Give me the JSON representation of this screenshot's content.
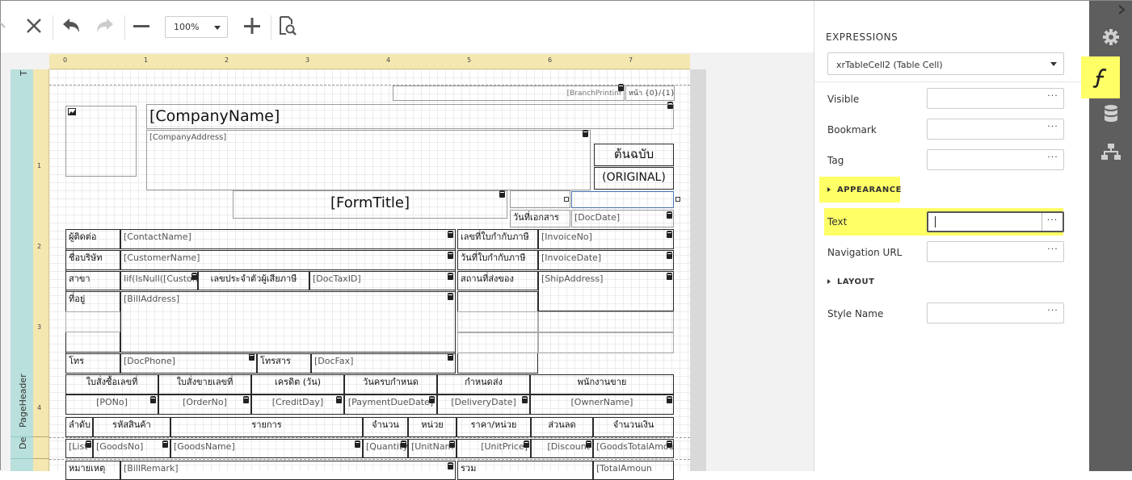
{
  "toolbar": {
    "zoom_value": "100%",
    "buttons": [
      "close-icon",
      "undo-icon",
      "redo-icon",
      "zoom-out-icon",
      "zoom-in-icon",
      "preview-icon"
    ]
  },
  "ruler": {
    "h_marks": [
      "0",
      "1",
      "2",
      "3",
      "4",
      "5",
      "6",
      "7"
    ],
    "v_marks": [
      "1",
      "2",
      "3",
      "4"
    ]
  },
  "bands": {
    "top": "T",
    "page_header": "PageHeader",
    "detail": "De"
  },
  "report": {
    "branch_printing": "[BranchPrintinf",
    "page_of": "หน้า {0}/{1}",
    "company_name": "[CompanyName]",
    "company_address": "[CompanyAddress]",
    "original_th": "ต้นฉบับ",
    "original_en": "(ORIGINAL)",
    "form_title": "[FormTitle]",
    "doc_date_label": "วันที่เอกสาร",
    "doc_date": "[DocDate]",
    "contact_label": "ผู้ติดต่อ",
    "contact_name": "[ContactName]",
    "invoice_no_label": "เลขที่ใบกำกับภาษี",
    "invoice_no": "[InvoiceNo]",
    "customer_label": "ชื่อบริษัท",
    "customer_name": "[CustomerName]",
    "invoice_date_label": "วันที่ใบกำกับภาษี",
    "invoice_date": "[InvoiceDate]",
    "branch_label": "สาขา",
    "branch_expr": "Iif(IsNull([Custom",
    "taxid_label": "เลขประจำตัวผู้เสียภาษี",
    "taxid": "[DocTaxID]",
    "ship_label": "สถานที่ส่งของ",
    "ship_address": "[ShipAddress]",
    "address_label": "ที่อยู่",
    "bill_address": "[BillAddress]",
    "phone_label": "โทร",
    "phone": "[DocPhone]",
    "fax_label": "โทรสาร",
    "fax": "[DocFax]",
    "header1": [
      "ใบสั่งซื้อเลขที่",
      "ใบสั่งขายเลขที่",
      "เครดิต (วัน)",
      "วันครบกำหนด",
      "กำหนดส่ง",
      "พนักงานขาย"
    ],
    "values1": [
      "[PONo]",
      "[OrderNo]",
      "[CreditDay]",
      "[PaymentDueDate]",
      "[DeliveryDate]",
      "[OwnerName]"
    ],
    "header2": [
      "ลำดับ",
      "รหัสสินค้า",
      "รายการ",
      "จำนวน",
      "หน่วย",
      "ราคา/หน่วย",
      "ส่วนลด",
      "จำนวนเงิน"
    ],
    "values2": [
      "[List",
      "[GoodsNo]",
      "[GoodsName]",
      "[Quantity",
      "[UnitNam",
      "[UnitPrice]",
      "[Discount",
      "[GoodsTotalAmou"
    ],
    "footer_left_label": "หมายเหตุ",
    "bill_remark": "[BillRemark]",
    "footer_mid_label": "รวม",
    "total_amount": "[TotalAmoun"
  },
  "panel": {
    "title": "EXPRESSIONS",
    "selected_component": "xrTableCell2 (Table Cell)",
    "props": {
      "visible": "Visible",
      "bookmark": "Bookmark",
      "tag": "Tag",
      "appearance": "APPEARANCE",
      "text": "Text",
      "navigation_url": "Navigation URL",
      "layout": "LAYOUT",
      "style_name": "Style Name"
    },
    "dots": "···"
  },
  "side_tabs": [
    "gear-icon",
    "function-icon",
    "database-icon",
    "tree-icon"
  ],
  "colors": {
    "highlight": "#ffff66",
    "side_tab_bg": "#5e5e5e",
    "ruler": "#f4e7b0",
    "band_strip": "#b9e0dc"
  }
}
